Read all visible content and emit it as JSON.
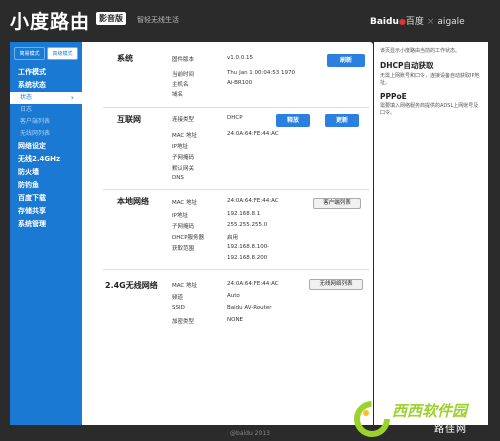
{
  "header": {
    "brand": "小度路由",
    "edition": "影音版",
    "slogan": "智轻无线生活",
    "logo_baidu": "Baidu",
    "logo_baidu_cn": "百度",
    "logo_partner": "aigale"
  },
  "sidebar": {
    "modes": [
      "简易模式",
      "高级模式"
    ],
    "active_mode": 1,
    "items": [
      {
        "label": "工作模式",
        "type": "nav"
      },
      {
        "label": "系统状态",
        "type": "nav"
      },
      {
        "label": "状态",
        "type": "sub",
        "active": true
      },
      {
        "label": "日志",
        "type": "sub"
      },
      {
        "label": "客户端列表",
        "type": "sub"
      },
      {
        "label": "无线网列表",
        "type": "sub"
      },
      {
        "label": "网络设定",
        "type": "nav"
      },
      {
        "label": "无线2.4GHz",
        "type": "nav"
      },
      {
        "label": "防火墙",
        "type": "nav"
      },
      {
        "label": "防钓鱼",
        "type": "nav"
      },
      {
        "label": "百度下载",
        "type": "nav"
      },
      {
        "label": "存储共享",
        "type": "nav"
      },
      {
        "label": "系统管理",
        "type": "nav"
      }
    ]
  },
  "system": {
    "title": "系统",
    "rows": [
      {
        "label": "固件版本",
        "value": "v1.0.0.15"
      },
      {
        "label": "当前时间",
        "value": "Thu Jan 1 00:04:53 1970"
      },
      {
        "label": "主机名",
        "value": "Ai-BR100"
      },
      {
        "label": "域名",
        "value": ""
      }
    ],
    "refresh_label": "刷新"
  },
  "internet": {
    "title": "互联网",
    "rows": [
      {
        "label": "连接类型",
        "value": "DHCP"
      },
      {
        "label": "MAC 地址",
        "value": "24:0A:64:FE:44:AC"
      },
      {
        "label": "IP地址",
        "value": ""
      },
      {
        "label": "子网掩码",
        "value": ""
      },
      {
        "label": "默认网关",
        "value": ""
      },
      {
        "label": "DNS",
        "value": ""
      }
    ],
    "release_label": "释放",
    "renew_label": "更新"
  },
  "lan": {
    "title": "本地网络",
    "rows": [
      {
        "label": "MAC 地址",
        "value": "24:0A:64:FE:44:AC"
      },
      {
        "label": "IP地址",
        "value": "192.168.8.1"
      },
      {
        "label": "子网掩码",
        "value": "255.255.255.0"
      },
      {
        "label": "DHCP服务器",
        "value": "启用"
      },
      {
        "label": "获取范围",
        "value": "192.168.8.100-"
      },
      {
        "label": "",
        "value": "192.168.8.200"
      }
    ],
    "client_list_label": "客户端列表"
  },
  "wifi": {
    "title": "2.4G无线网络",
    "rows": [
      {
        "label": "MAC 地址",
        "value": "24:0A:64:FE:44:AC"
      },
      {
        "label": "频道",
        "value": "Auto"
      },
      {
        "label": "SSID",
        "value": "Baidu AV-Router"
      },
      {
        "label": "加密类型",
        "value": "NONE"
      }
    ],
    "wifi_list_label": "无线网络列表"
  },
  "help": {
    "intro": "该页显示小度路由当前的工作状态。",
    "dhcp_title": "DHCP自动获取",
    "dhcp_text": "无需上网账号和口令，连接设备自动获取IP地址。",
    "pppoe_title": "PPPoE",
    "pppoe_text": "需要填入网络服务商提供的ADSL上网账号及口令。"
  },
  "footer": {
    "copyright": "@baidu 2013"
  },
  "watermark": {
    "text": "西西软件园",
    "url": "路佳网"
  }
}
